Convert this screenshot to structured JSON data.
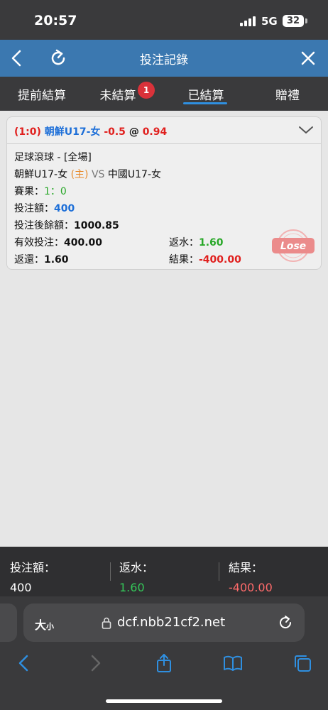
{
  "status_bar": {
    "time": "20:57",
    "network": "5G",
    "battery": "32"
  },
  "header": {
    "title": "投注記錄"
  },
  "tabs": [
    {
      "label": "提前結算"
    },
    {
      "label": "未結算",
      "badge": "1"
    },
    {
      "label": "已結算",
      "active": true
    },
    {
      "label": "贈禮"
    }
  ],
  "bet": {
    "score_prefix": "(1:0)",
    "team_line": "朝鮮U17-女",
    "handicap": "-0.5",
    "at": "@",
    "odds": "0.94",
    "market": "足球滾球 - [全場]",
    "home_team": "朝鮮U17-女",
    "home_tag": "(主)",
    "vs": "VS",
    "away_team": "中國U17-女",
    "result_label": "賽果：",
    "result_value": "1：0",
    "stake_label": "投注額：",
    "stake_value": "400",
    "balance_label": "投注後餘額：",
    "balance_value": "1000.85",
    "valid_label": "有效投注：",
    "valid_value": "400.00",
    "rebate_label": "返水：",
    "rebate_value": "1.60",
    "return_label": "返還：",
    "return_value": "1.60",
    "outcome_label": "結果：",
    "outcome_value": "-400.00",
    "stamp": "Lose"
  },
  "summary": {
    "stake_label": "投注額：",
    "stake_value": "400",
    "rebate_label": "返水：",
    "rebate_value": "1.60",
    "result_label": "結果：",
    "result_value": "-400.00"
  },
  "browser": {
    "text_size_big": "大",
    "text_size_small": "小",
    "url": "dcf.nbb21cf2.net"
  },
  "colors": {
    "header": "#3b78b0",
    "accent": "#2f8fe0",
    "red": "#e0201e",
    "green": "#29a829",
    "blue": "#1d6fd8"
  }
}
